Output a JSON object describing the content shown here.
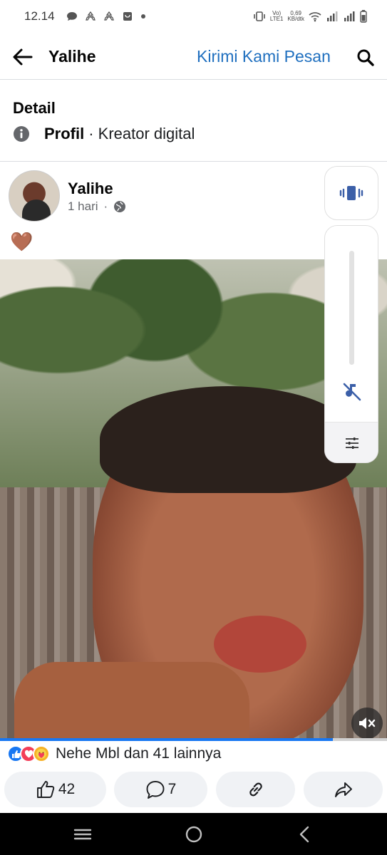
{
  "status_bar": {
    "time": "12.14",
    "network_label_top": "Vo)",
    "network_label_bottom": "LTE1",
    "speed_top": "0,69",
    "speed_bottom": "KB/dtk",
    "icons": [
      "chat-bubble-icon",
      "recycle-icon",
      "recycle-icon",
      "bag-icon",
      "dot-icon",
      "vibrate-icon",
      "wifi-icon",
      "signal-icon",
      "signal-icon",
      "battery-icon"
    ]
  },
  "header": {
    "title": "Yalihe",
    "message_link": "Kirimi Kami Pesan",
    "back_icon": "arrow-left-icon",
    "search_icon": "search-icon"
  },
  "detail": {
    "title": "Detail",
    "profile_label": "Profil",
    "profile_rest": "· Kreator digital",
    "icon": "info-icon"
  },
  "post": {
    "author": "Yalihe",
    "time": "1 hari",
    "separator": "·",
    "privacy_icon": "globe-icon",
    "text": "🤎"
  },
  "video": {
    "progress_fraction": 0.86,
    "mute_icon": "speaker-muted-icon"
  },
  "volume_panel": {
    "level_fraction": 0.0,
    "vibrate_icon": "vibrate-icon",
    "mute_icon": "music-note-muted-icon",
    "settings_icon": "sliders-icon"
  },
  "reactions": {
    "text": "Nehe Mbl dan 41 lainnya",
    "icons": [
      "like-icon",
      "love-icon",
      "care-icon"
    ]
  },
  "actions": {
    "like_count": "42",
    "comment_count": "7"
  },
  "colors": {
    "link_blue": "#1f6fbf",
    "facebook_blue": "#1877f2",
    "pill_bg": "#f0f2f5"
  }
}
